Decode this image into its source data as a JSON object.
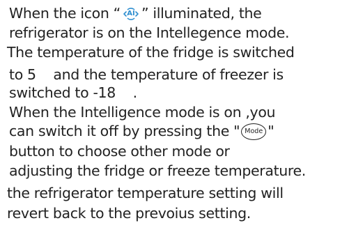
{
  "lines": {
    "l1_a": "When the icon “",
    "l1_b": "” illuminated, the",
    "l2": "refrigerator is on the Intellegence mode.",
    "l3": "The temperature of the fridge is switched",
    "l4": "to 5    and the temperature of freezer is",
    "l5": "switched to -18    .",
    "l6": "When the Intelligence mode is on ,you",
    "l7_a": "can switch it off by pressing the \"",
    "l7_b": "\"",
    "l8": "button to choose other mode  or",
    "l9": "adjusting the fridge or freeze temperature.",
    "l10": "the refrigerator temperature setting will",
    "l11": "revert back to the prevoius setting."
  },
  "icons": {
    "ai_icon_text": "AI",
    "mode_button_text": "Mode"
  }
}
